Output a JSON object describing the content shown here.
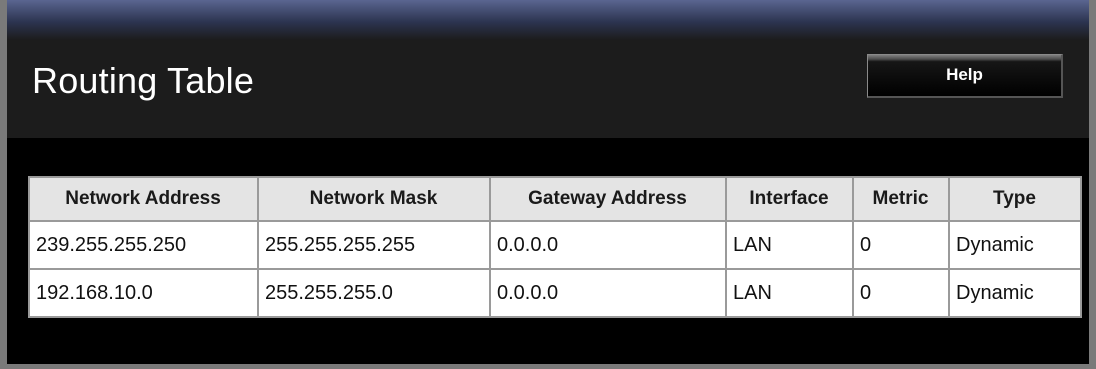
{
  "page": {
    "title": "Routing Table",
    "help_label": "Help"
  },
  "table": {
    "columns": [
      "Network Address",
      "Network Mask",
      "Gateway Address",
      "Interface",
      "Metric",
      "Type"
    ],
    "rows": [
      [
        "239.255.255.250",
        "255.255.255.255",
        "0.0.0.0",
        "LAN",
        "0",
        "Dynamic"
      ],
      [
        "192.168.10.0",
        "255.255.255.0",
        "0.0.0.0",
        "LAN",
        "0",
        "Dynamic"
      ]
    ]
  },
  "colors": {
    "header_bar": "#1c1c1c",
    "top_gradient": "#5a6590",
    "table_header_bg": "#e4e4e4"
  }
}
